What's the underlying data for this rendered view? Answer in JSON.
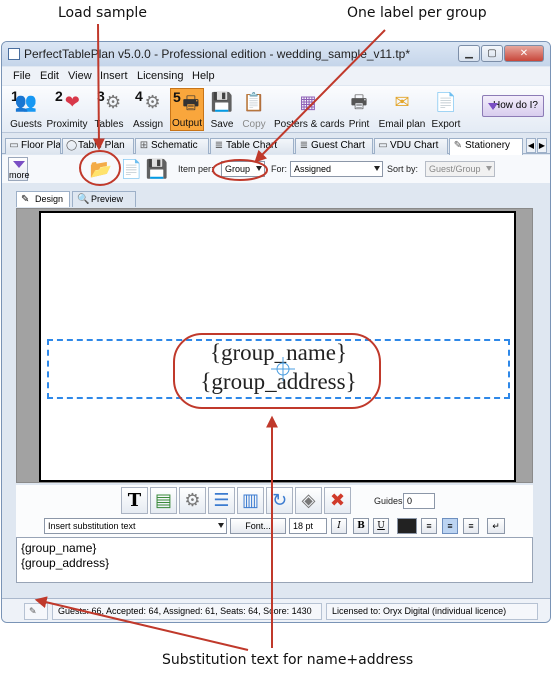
{
  "annotations": {
    "load_sample": "Load sample",
    "one_label_per_group": "One label per group",
    "substitution_text": "Substitution text for name+address"
  },
  "window": {
    "title": "PerfectTablePlan v5.0.0 - Professional edition - wedding_sample_v11.tp*"
  },
  "menu": [
    "File",
    "Edit",
    "View",
    "Insert",
    "Licensing",
    "Help"
  ],
  "toolbar": {
    "buttons": [
      {
        "num": "1",
        "label": "Guests",
        "icon": "guests-icon",
        "glyph": "👥"
      },
      {
        "num": "2",
        "label": "Proximity",
        "icon": "heart-icon",
        "glyph": "❤"
      },
      {
        "num": "3",
        "label": "Tables",
        "icon": "table-icon",
        "glyph": "⚙"
      },
      {
        "num": "4",
        "label": "Assign",
        "icon": "assign-icon",
        "glyph": "⚙"
      },
      {
        "num": "5",
        "label": "Output",
        "icon": "printer-icon",
        "glyph": "🖶"
      },
      {
        "num": "",
        "label": "Save",
        "icon": "save-icon",
        "glyph": "💾"
      },
      {
        "num": "",
        "label": "Copy",
        "icon": "copy-icon",
        "glyph": "📋"
      },
      {
        "num": "",
        "label": "Posters & cards",
        "icon": "posters-icon",
        "glyph": "▦"
      },
      {
        "num": "",
        "label": "Print",
        "icon": "print-icon",
        "glyph": "🖶"
      },
      {
        "num": "",
        "label": "Email plan",
        "icon": "email-icon",
        "glyph": "✉"
      },
      {
        "num": "",
        "label": "Export",
        "icon": "export-icon",
        "glyph": "📄"
      }
    ],
    "how_do_i": "How do I?"
  },
  "tabs": [
    {
      "label": "Floor Plan",
      "icon": "floor-plan-icon",
      "glyph": "▭"
    },
    {
      "label": "Table Plan",
      "icon": "table-plan-icon",
      "glyph": "◯"
    },
    {
      "label": "Schematic",
      "icon": "schematic-icon",
      "glyph": "⊞"
    },
    {
      "label": "Table Chart",
      "icon": "table-chart-icon",
      "glyph": "≣"
    },
    {
      "label": "Guest Chart",
      "icon": "guest-chart-icon",
      "glyph": "≣"
    },
    {
      "label": "VDU Chart",
      "icon": "vdu-chart-icon",
      "glyph": "▭"
    },
    {
      "label": "Stationery",
      "icon": "stationery-icon",
      "glyph": "✎"
    }
  ],
  "options": {
    "more": "more",
    "item_per_label": "Item per:",
    "item_per_value": "Group",
    "for_label": "For:",
    "for_value": "Assigned",
    "sort_by_label": "Sort by:",
    "sort_by_value": "Guest/Group"
  },
  "subtabs": [
    "Design",
    "Preview"
  ],
  "template": {
    "line1": "{group_name}",
    "line2": "{group_address}"
  },
  "formatting": {
    "guides_label": "Guides:",
    "guides_value": "0",
    "insert_substitution": "Insert substitution text",
    "font_button": "Font...",
    "font_size": "18 pt",
    "italic": "I",
    "bold": "B",
    "underline": "U"
  },
  "editor": {
    "line1": "{group_name}",
    "line2": "{group_address}"
  },
  "status": {
    "stats": "Guests: 66, Accepted: 64, Assigned: 61, Seats: 64, Score: 1430",
    "license": "Licensed to: Oryx Digital (individual licence)"
  },
  "colors": {
    "annotation_red": "#c0392b",
    "output_active": "#f9a63c",
    "guide_blue": "#2e88e8"
  }
}
